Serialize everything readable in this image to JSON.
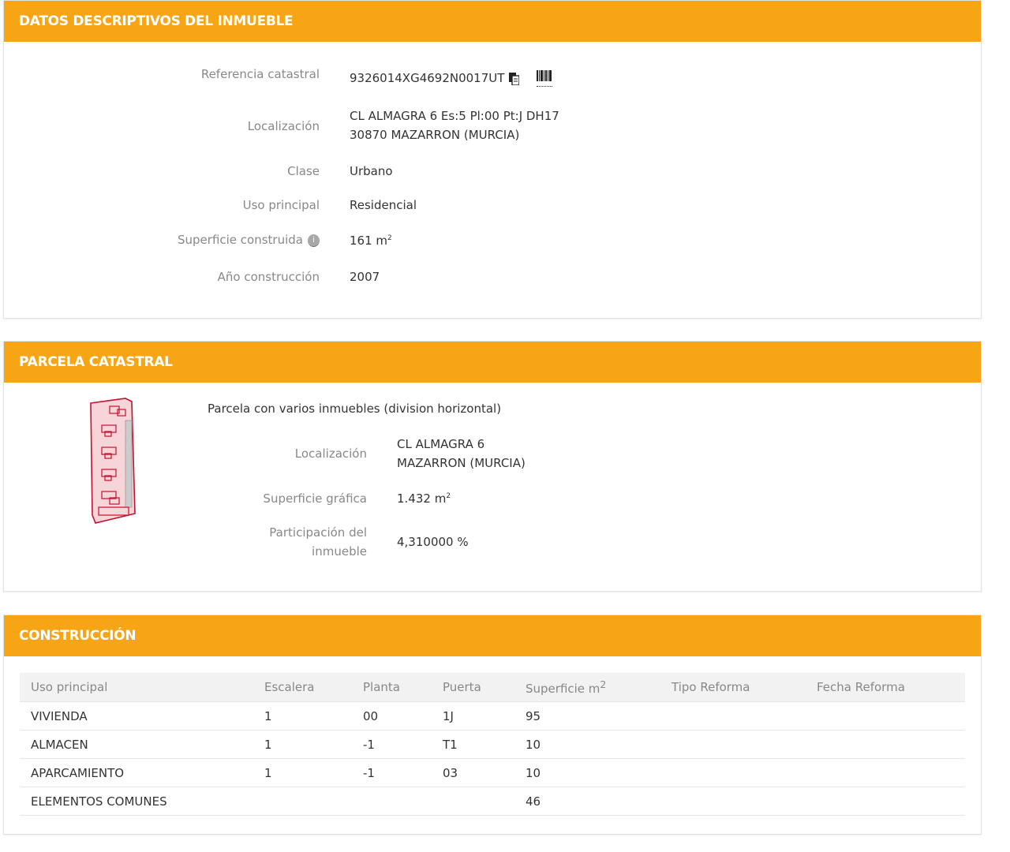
{
  "datos": {
    "title": "DATOS DESCRIPTIVOS DEL INMUEBLE",
    "referencia_label": "Referencia catastral",
    "referencia_value": "9326014XG4692N0017UT",
    "localizacion_label": "Localización",
    "localizacion_line1": "CL ALMAGRA 6 Es:5 Pl:00 Pt:J DH17",
    "localizacion_line2": "30870 MAZARRON (MURCIA)",
    "clase_label": "Clase",
    "clase_value": "Urbano",
    "uso_label": "Uso principal",
    "uso_value": "Residencial",
    "superficie_label": "Superficie construida",
    "superficie_value": "161 m",
    "superficie_unit_sup": "2",
    "anio_label": "Año construcción",
    "anio_value": "2007"
  },
  "parcela": {
    "title": "PARCELA CATASTRAL",
    "description": "Parcela con varios inmuebles (division horizontal)",
    "localizacion_label": "Localización",
    "localizacion_line1": "CL ALMAGRA 6",
    "localizacion_line2": "MAZARRON (MURCIA)",
    "superficie_label": "Superficie gráfica",
    "superficie_value": "1.432 m",
    "superficie_unit_sup": "2",
    "participacion_label_line1": "Participación del",
    "participacion_label_line2": "inmueble",
    "participacion_value": "4,310000 %"
  },
  "construccion": {
    "title": "CONSTRUCCIÓN",
    "headers": {
      "uso": "Uso principal",
      "escalera": "Escalera",
      "planta": "Planta",
      "puerta": "Puerta",
      "superficie": "Superficie m",
      "superficie_sup": "2",
      "tipo_reforma": "Tipo Reforma",
      "fecha_reforma": "Fecha Reforma"
    },
    "rows": [
      {
        "uso": "VIVIENDA",
        "escalera": "1",
        "planta": "00",
        "puerta": "1J",
        "superficie": "95",
        "tipo_reforma": "",
        "fecha_reforma": ""
      },
      {
        "uso": "ALMACEN",
        "escalera": "1",
        "planta": "-1",
        "puerta": "T1",
        "superficie": "10",
        "tipo_reforma": "",
        "fecha_reforma": ""
      },
      {
        "uso": "APARCAMIENTO",
        "escalera": "1",
        "planta": "-1",
        "puerta": "03",
        "superficie": "10",
        "tipo_reforma": "",
        "fecha_reforma": ""
      },
      {
        "uso": "ELEMENTOS COMUNES",
        "escalera": "",
        "planta": "",
        "puerta": "",
        "superficie": "46",
        "tipo_reforma": "",
        "fecha_reforma": ""
      }
    ]
  },
  "icons": {
    "copy": "copy-document-icon",
    "barcode": "barcode-icon",
    "info": "info-icon",
    "parcel": "parcel-map-thumbnail"
  },
  "colors": {
    "header_bg": "#f7a515",
    "header_text": "#ffffff",
    "label_text": "#888888",
    "value_text": "#333333",
    "parcel_stroke": "#c8102e",
    "parcel_fill": "#f7d4d8"
  }
}
